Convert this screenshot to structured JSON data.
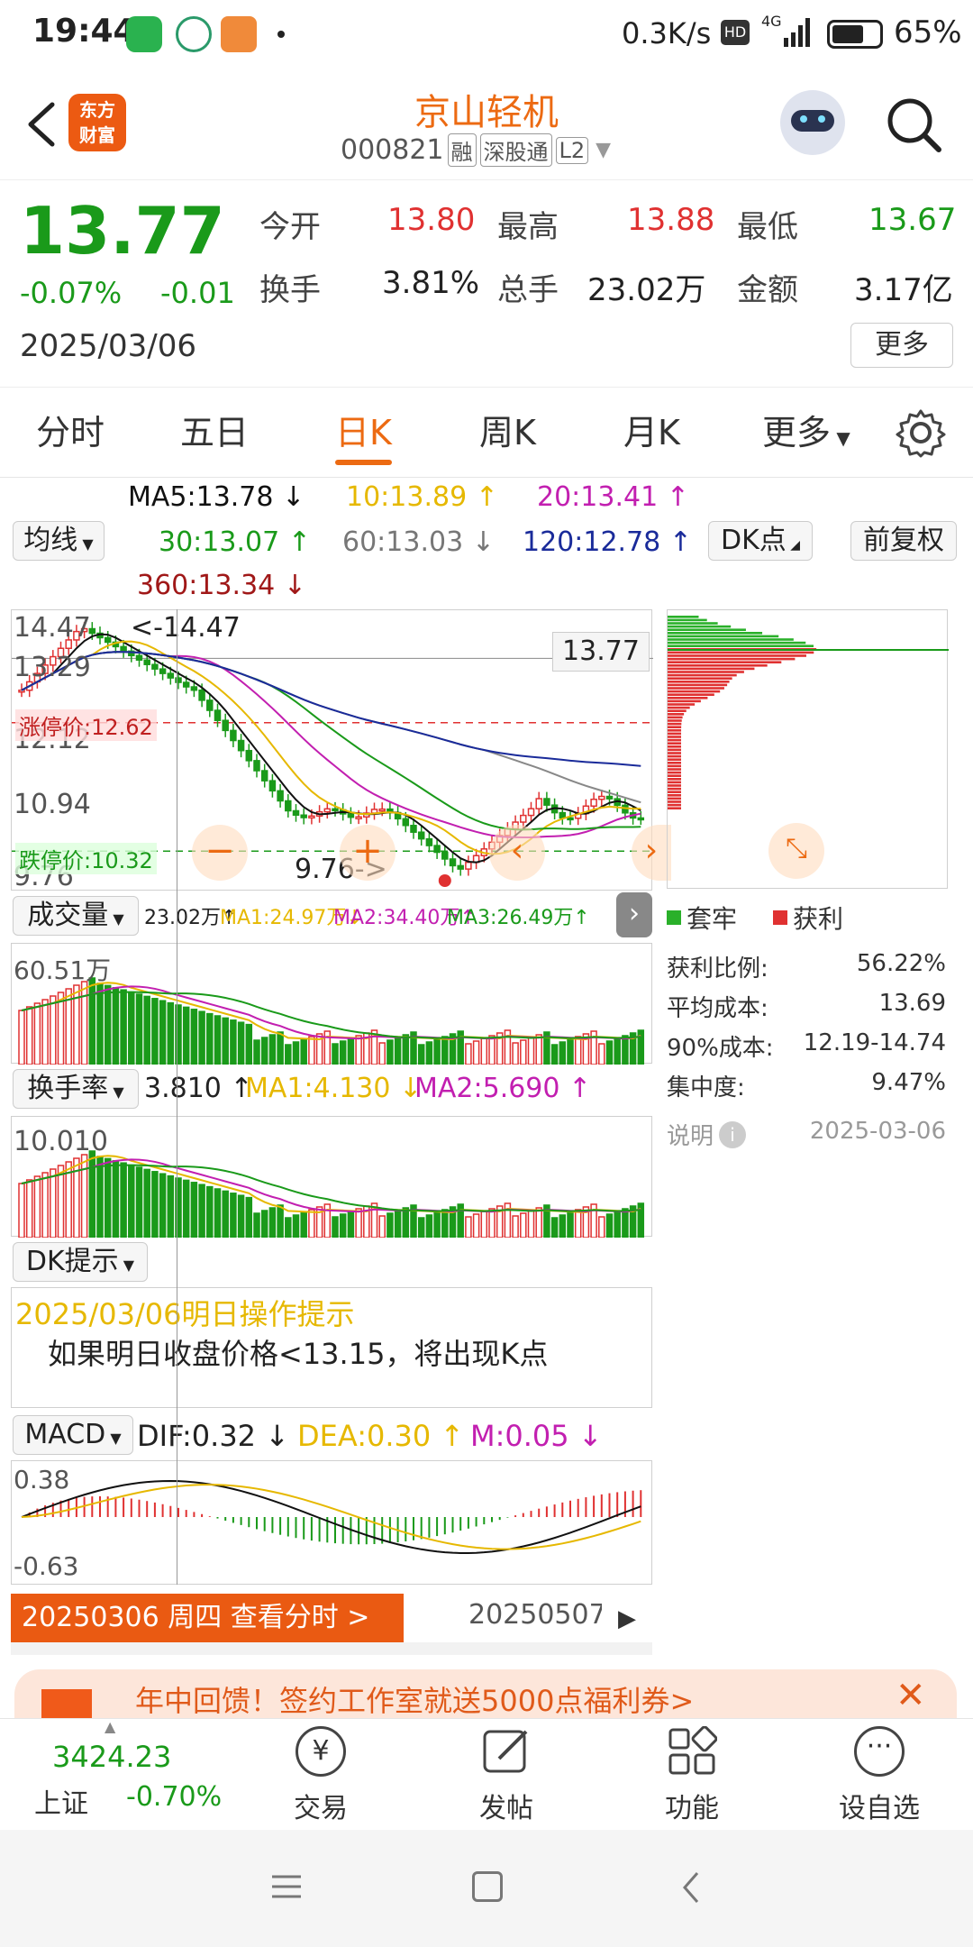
{
  "status_bar": {
    "time": "19:44",
    "network_speed": "0.3K/s",
    "signal": "4G",
    "battery": "65%",
    "icons": [
      "wechat-icon",
      "app-icon",
      "game-icon",
      "dot-icon"
    ]
  },
  "header": {
    "logo_line1": "东方",
    "logo_line2": "财富",
    "stock_name": "京山轻机",
    "stock_code": "000821",
    "tags": [
      "融",
      "深股通",
      "L2"
    ]
  },
  "quote": {
    "price": "13.77",
    "change_pct": "-0.07%",
    "change": "-0.01",
    "date": "2025/03/06",
    "fields": [
      {
        "label": "今开",
        "value": "13.80",
        "color": "#e03131"
      },
      {
        "label": "最高",
        "value": "13.88",
        "color": "#e03131"
      },
      {
        "label": "最低",
        "value": "13.67",
        "color": "#1a9a1a"
      },
      {
        "label": "换手",
        "value": "3.81%",
        "color": "#222222"
      },
      {
        "label": "总手",
        "value": "23.02万",
        "color": "#222222"
      },
      {
        "label": "金额",
        "value": "3.17亿",
        "color": "#222222"
      }
    ],
    "more_label": "更多"
  },
  "tabs": [
    "分时",
    "五日",
    "日K",
    "周K",
    "月K",
    "更多"
  ],
  "active_tab": "日K",
  "ma_controls": {
    "ma_select": "均线",
    "dk_label": "DK点",
    "fq_label": "前复权",
    "ma5": "MA5:13.78 ↓",
    "ma10": "10:13.89 ↑",
    "ma20": "20:13.41 ↑",
    "ma30": "30:13.07 ↑",
    "ma60": "60:13.03 ↓",
    "ma120": "120:12.78 ↑",
    "ma360": "360:13.34 ↓"
  },
  "kline_labels": {
    "y_top": "14.47",
    "y_2": "13.29",
    "y_3": "12.12",
    "y_4": "10.94",
    "y_bottom": "9.76",
    "high_marker": "<-14.47",
    "low_marker": "9.76->",
    "last_price": "13.77",
    "limit_up": "涨停价:12.62",
    "limit_down": "跌停价:10.32"
  },
  "chip_stats": {
    "legend_trapped": "套牢",
    "legend_profit": "获利",
    "rows": [
      {
        "label": "获利比例:",
        "value": "56.22%"
      },
      {
        "label": "平均成本:",
        "value": "13.69"
      },
      {
        "label": "90%成本:",
        "value": "12.19-14.74"
      },
      {
        "label": "集中度:",
        "value": "9.47%"
      }
    ],
    "note_label": "说明",
    "note_date": "2025-03-06"
  },
  "volume": {
    "select": "成交量",
    "info": "23.02万↑",
    "ma1": "MA1:24.97万↓",
    "ma2": "MA2:34.40万↑",
    "ma3": "MA3:26.49万↑",
    "y_top": "60.51万"
  },
  "turnover": {
    "select": "换手率",
    "value": "3.810 ↑",
    "ma1": "MA1:4.130 ↓",
    "ma2": "MA2:5.690 ↑",
    "y_top": "10.010"
  },
  "dk_tip": {
    "select": "DK提示",
    "title": "2025/03/06明日操作提示",
    "body": "如果明日收盘价格<13.15，将出现K点"
  },
  "macd": {
    "select": "MACD",
    "dif": "DIF:0.32 ↓",
    "dea": "DEA:0.30 ↑",
    "m": "M:0.05 ↓",
    "y_top": "0.38",
    "y_bottom": "-0.63"
  },
  "date_bar": {
    "button": "20250306 周四 查看分时 >",
    "end_date": "20250507"
  },
  "banner": {
    "text": "年中回馈！签约工作室就送5000点福利券>"
  },
  "bottom_nav": {
    "index_value": "3424.23",
    "index_name": "上证",
    "index_change": "-0.70%",
    "items": [
      "交易",
      "发帖",
      "功能",
      "设自选"
    ]
  },
  "colors": {
    "accent": "#ec6a12",
    "up": "#e03131",
    "down": "#1a9a1a",
    "ma5": "#111111",
    "ma10": "#e6b800",
    "ma20": "#c21fb0",
    "ma30": "#1a9a1a",
    "ma60": "#888888",
    "ma120": "#1a2b9a",
    "ma360": "#a01818"
  }
}
